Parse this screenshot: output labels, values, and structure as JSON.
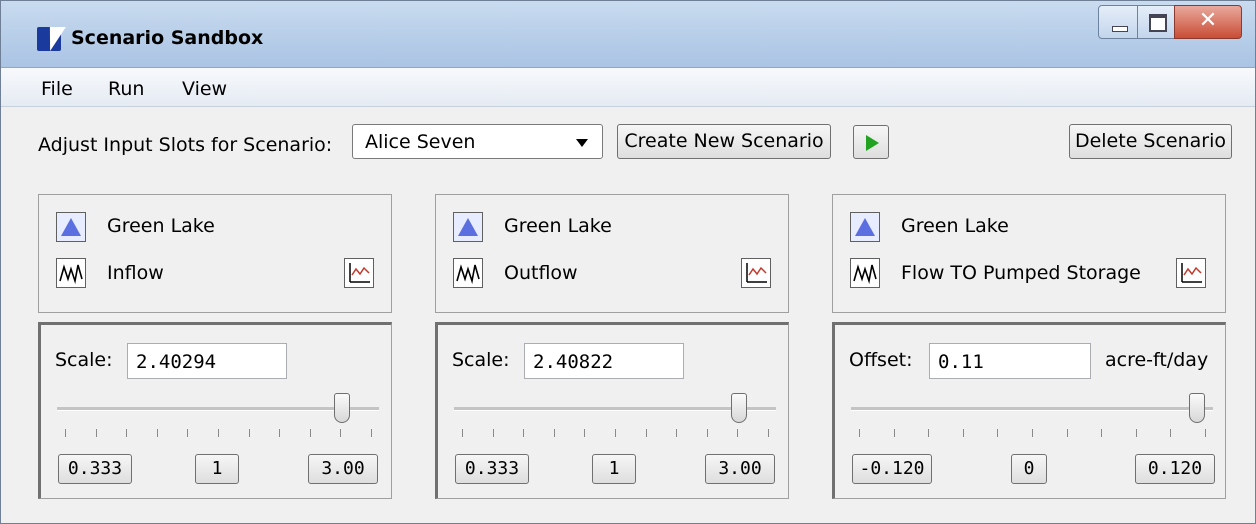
{
  "window": {
    "title": "Scenario Sandbox"
  },
  "menu": [
    "File",
    "Run",
    "View"
  ],
  "toolbar": {
    "label": "Adjust Input Slots for Scenario:",
    "scenario_selected": "Alice Seven",
    "create_button": "Create New Scenario",
    "delete_button": "Delete Scenario"
  },
  "panels": [
    {
      "object": "Green Lake",
      "slot": "Inflow",
      "param_label": "Scale:",
      "value": "2.40294",
      "unit": "",
      "slider_fraction": 0.885,
      "min": "0.333",
      "mid": "1",
      "max": "3.00"
    },
    {
      "object": "Green Lake",
      "slot": "Outflow",
      "param_label": "Scale:",
      "value": "2.40822",
      "unit": "",
      "slider_fraction": 0.885,
      "min": "0.333",
      "mid": "1",
      "max": "3.00"
    },
    {
      "object": "Green Lake",
      "slot": "Flow TO Pumped Storage",
      "param_label": "Offset:",
      "value": "0.11",
      "unit": "acre-ft/day",
      "slider_fraction": 0.955,
      "min": "-0.120",
      "mid": "0",
      "max": "0.120"
    }
  ],
  "colors": {
    "titlebar": "#b9cfe9",
    "run_icon": "#21a321",
    "object_icon": "#5b6fe0",
    "close_button": "#c94d35"
  },
  "icons": {
    "object": "reservoir-triangle-icon",
    "slot": "timeseries-slot-icon",
    "plot": "plot-icon",
    "run": "play-icon"
  }
}
